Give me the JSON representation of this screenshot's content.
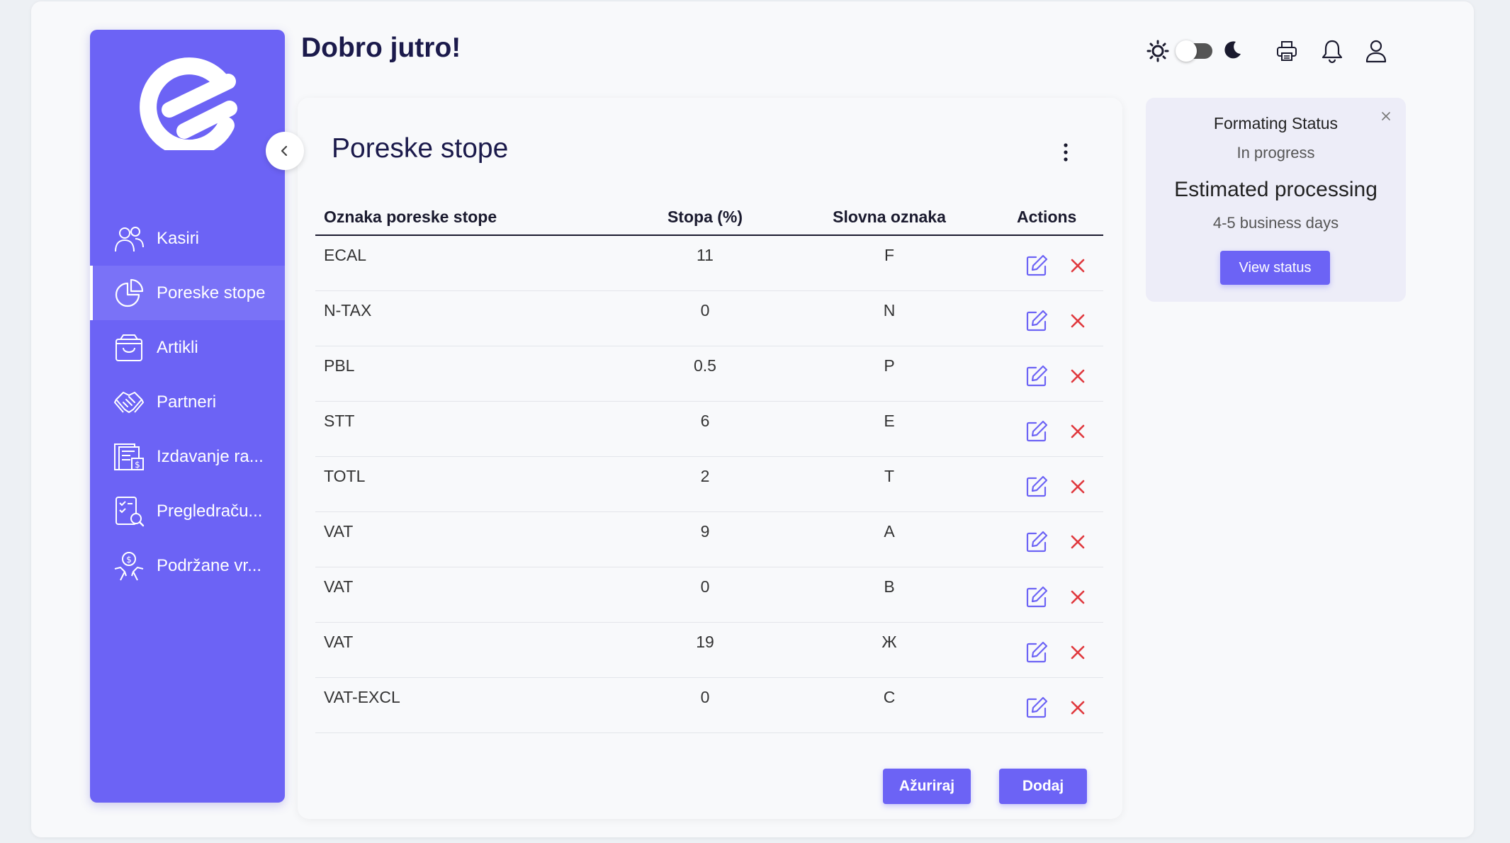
{
  "header": {
    "greeting": "Dobro jutro!"
  },
  "sidebar": {
    "items": [
      {
        "label": "Kasiri",
        "icon": "users-icon",
        "active": false
      },
      {
        "label": "Poreske stope",
        "icon": "pie-chart-icon",
        "active": true
      },
      {
        "label": "Artikli",
        "icon": "shopping-bag-icon",
        "active": false
      },
      {
        "label": "Partneri",
        "icon": "handshake-icon",
        "active": false
      },
      {
        "label": "Izdavanje ra...",
        "icon": "invoice-icon",
        "active": false
      },
      {
        "label": "Pregledraču...",
        "icon": "checklist-search-icon",
        "active": false
      },
      {
        "label": "Podržane vr...",
        "icon": "hand-coin-icon",
        "active": false
      }
    ]
  },
  "main": {
    "title": "Poreske stope",
    "table": {
      "headers": [
        "Oznaka poreske stope",
        "Stopa (%)",
        "Slovna oznaka",
        "Actions"
      ],
      "rows": [
        {
          "code": "ECAL",
          "rate": "11",
          "letter": "F"
        },
        {
          "code": "N-TAX",
          "rate": "0",
          "letter": "N"
        },
        {
          "code": "PBL",
          "rate": "0.5",
          "letter": "P"
        },
        {
          "code": "STT",
          "rate": "6",
          "letter": "E"
        },
        {
          "code": "TOTL",
          "rate": "2",
          "letter": "T"
        },
        {
          "code": "VAT",
          "rate": "9",
          "letter": "A"
        },
        {
          "code": "VAT",
          "rate": "0",
          "letter": "B"
        },
        {
          "code": "VAT",
          "rate": "19",
          "letter": "Ж"
        },
        {
          "code": "VAT-EXCL",
          "rate": "0",
          "letter": "C"
        }
      ]
    },
    "buttons": {
      "update": "Ažuriraj",
      "add": "Dodaj"
    }
  },
  "status_panel": {
    "title": "Formating Status",
    "state": "In progress",
    "estimate_label": "Estimated processing",
    "estimate_value": "4-5 business days",
    "button": "View status"
  },
  "colors": {
    "accent": "#6c63f5",
    "delete": "#e0393e",
    "edit": "#6c63f5"
  }
}
